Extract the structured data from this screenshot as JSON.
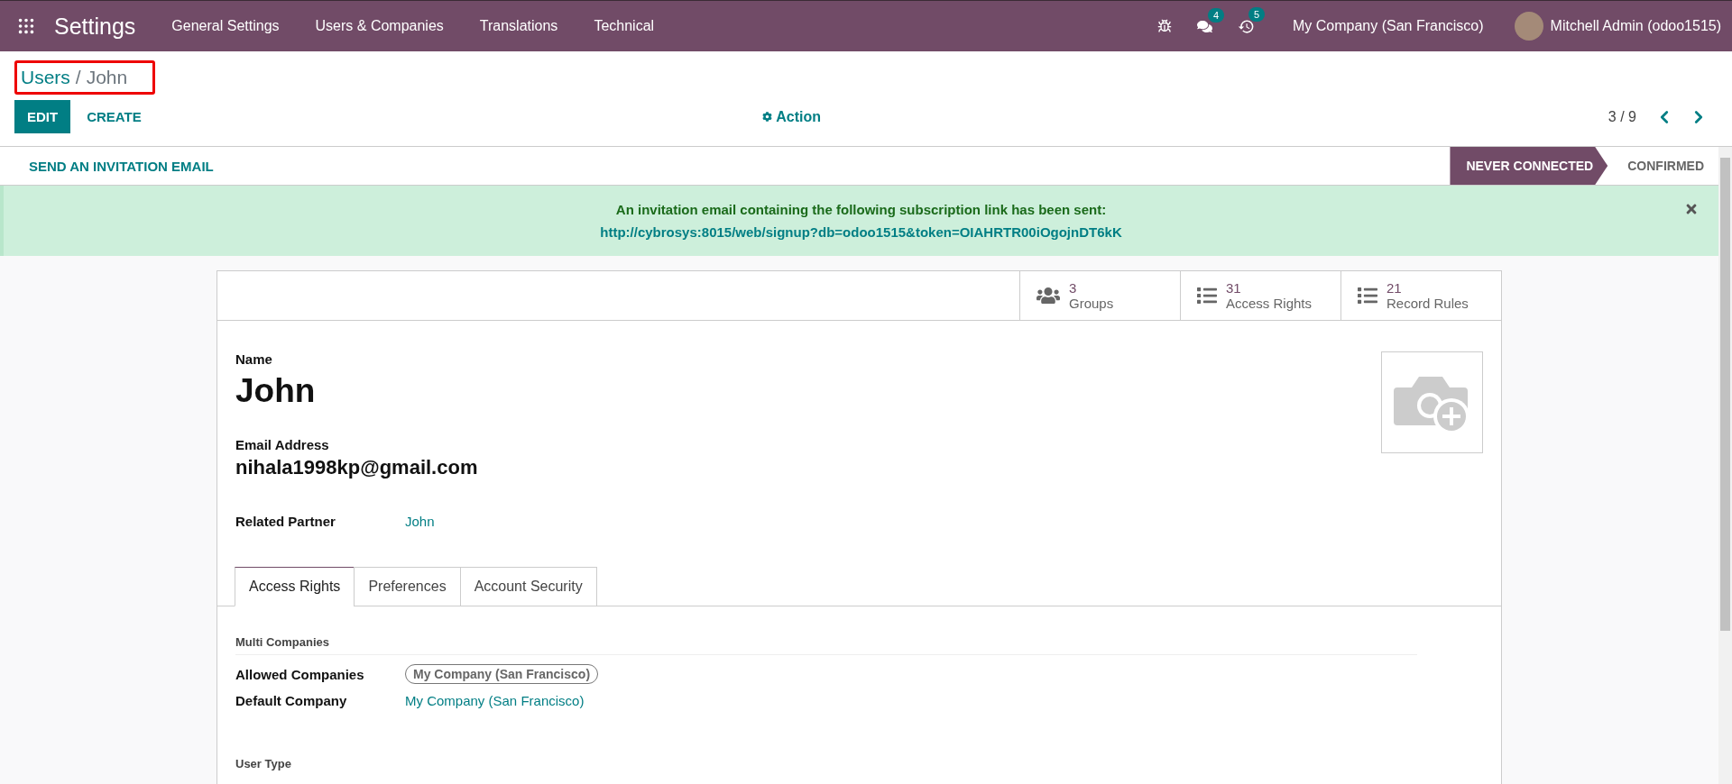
{
  "app": {
    "title": "Settings"
  },
  "menu": [
    "General Settings",
    "Users & Companies",
    "Translations",
    "Technical"
  ],
  "systray": {
    "messages_badge": "4",
    "activities_badge": "5",
    "company": "My Company (San Francisco)",
    "user": "Mitchell Admin (odoo1515)"
  },
  "breadcrumb": {
    "parent": "Users",
    "separator": "/",
    "current": "John"
  },
  "control_buttons": [
    {
      "label": "EDIT",
      "kind": "primary"
    },
    {
      "label": "CREATE",
      "kind": "secondary"
    }
  ],
  "action": "Action",
  "pager": "3 / 9",
  "header_button": "SEND AN INVITATION EMAIL",
  "statusbar": [
    {
      "label": "NEVER CONNECTED",
      "selected": true
    },
    {
      "label": "CONFIRMED",
      "selected": false
    }
  ],
  "alert": {
    "message": "An invitation email containing the following subscription link has been sent:",
    "link": "http://cybrosys:8015/web/signup?db=odoo1515&token=OIAHRTR00iOgojnDT6kK"
  },
  "smart_buttons": [
    {
      "value": "3",
      "label": "Groups",
      "kind": "groups"
    },
    {
      "value": "31",
      "label": "Access Rights",
      "kind": "list"
    },
    {
      "value": "21",
      "label": "Record Rules",
      "kind": "list"
    }
  ],
  "form": {
    "name_label": "Name",
    "name": "John",
    "email_label": "Email Address",
    "email": "nihala1998kp@gmail.com",
    "related_label": "Related Partner",
    "related_value": "John"
  },
  "tabs": [
    {
      "label": "Access Rights",
      "selected": true
    },
    {
      "label": "Preferences",
      "selected": false
    },
    {
      "label": "Account Security",
      "selected": false
    }
  ],
  "section": {
    "title": "Multi Companies",
    "fields": [
      {
        "label": "Allowed Companies",
        "value": "My Company (San Francisco)",
        "kind": "tag"
      },
      {
        "label": "Default Company",
        "value": "My Company (San Francisco)",
        "kind": "link"
      }
    ]
  },
  "next_section": "User Type"
}
